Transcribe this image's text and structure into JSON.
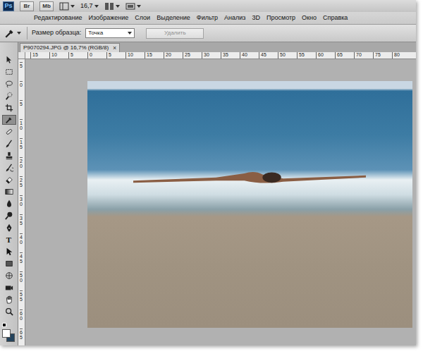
{
  "app_bar": {
    "logo": "Ps",
    "apps": [
      "Br",
      "Mb"
    ],
    "zoom": "16,7"
  },
  "menu": [
    "Редактирование",
    "Изображение",
    "Слои",
    "Выделение",
    "Фильтр",
    "Анализ",
    "3D",
    "Просмотр",
    "Окно",
    "Справка"
  ],
  "options": {
    "sample_label": "Размер образца:",
    "sample_value": "Точка",
    "delete": {
      "label": "Удалить",
      "disabled": true
    }
  },
  "document": {
    "tab": "P9070294.JPG @ 16,7% (RGB/8)",
    "close": "×"
  },
  "rulers": {
    "horizontal": [
      "15",
      "10",
      "5",
      "0",
      "5",
      "10",
      "15",
      "20",
      "25",
      "30",
      "35",
      "40",
      "45",
      "50",
      "55",
      "60",
      "65",
      "70",
      "75",
      "80"
    ],
    "vertical": [
      "5",
      "0",
      "5",
      "10",
      "15",
      "20",
      "25",
      "30",
      "35",
      "40",
      "45",
      "50",
      "55",
      "60",
      "65"
    ]
  },
  "tools": [
    {
      "selected": false
    },
    {
      "selected": false
    },
    {
      "selected": false
    },
    {
      "selected": false
    },
    {
      "selected": false
    },
    {
      "selected": true
    },
    {
      "selected": false
    },
    {
      "selected": false
    },
    {
      "selected": false
    },
    {
      "selected": false
    },
    {
      "selected": false
    },
    {
      "selected": false
    },
    {
      "selected": false
    },
    {
      "selected": false
    },
    {
      "selected": false
    },
    {
      "selected": false,
      "label": "T"
    },
    {
      "selected": false
    },
    {
      "selected": false
    },
    {
      "selected": false
    },
    {
      "selected": false
    },
    {
      "selected": false
    },
    {
      "selected": false
    }
  ],
  "swatches": {
    "foreground": "#ffffff",
    "background": "#24435c"
  }
}
